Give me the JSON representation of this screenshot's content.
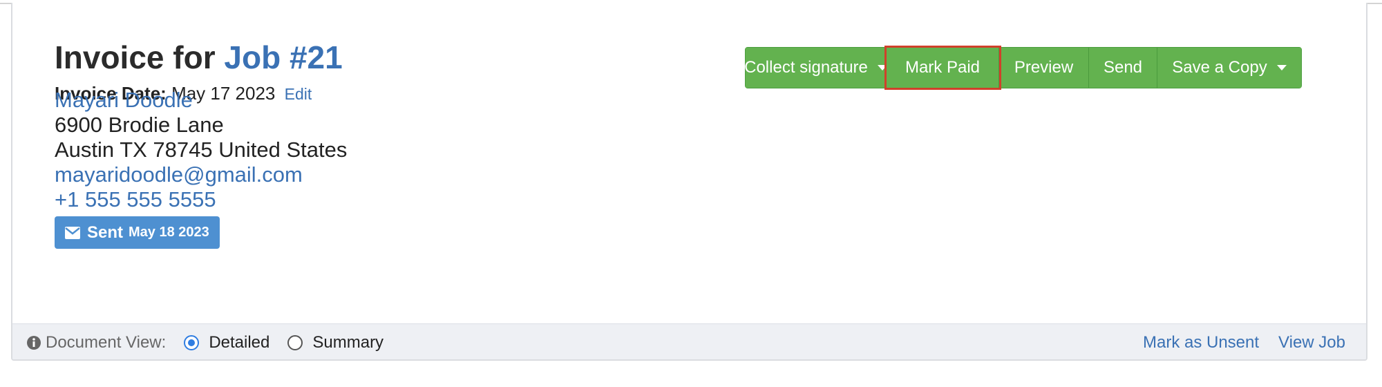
{
  "invoice": {
    "title_prefix": "Invoice for",
    "job_link": "Job #21",
    "date_label": "Invoice Date:",
    "date_value": "May 17 2023",
    "edit_label": "Edit"
  },
  "client": {
    "name": "Mayari Doodle",
    "address_line1": "6900 Brodie Lane",
    "address_line2": "Austin TX 78745 United States",
    "email": "mayaridoodle@gmail.com",
    "phone": "+1 555 555 5555"
  },
  "status_badge": {
    "icon": "envelope-icon",
    "label": "Sent",
    "date": "May 18 2023",
    "color": "#4e90d1"
  },
  "toolbar": {
    "collect_signature": "Collect signature",
    "mark_paid": "Mark Paid",
    "preview": "Preview",
    "send": "Send",
    "save_copy": "Save a Copy",
    "accent": "#63b24f",
    "highlight": "#d0402a"
  },
  "footer": {
    "doc_view_label": "Document View:",
    "options": [
      "Detailed",
      "Summary"
    ],
    "selected": "Detailed",
    "mark_unsent": "Mark as Unsent",
    "view_job": "View Job"
  }
}
